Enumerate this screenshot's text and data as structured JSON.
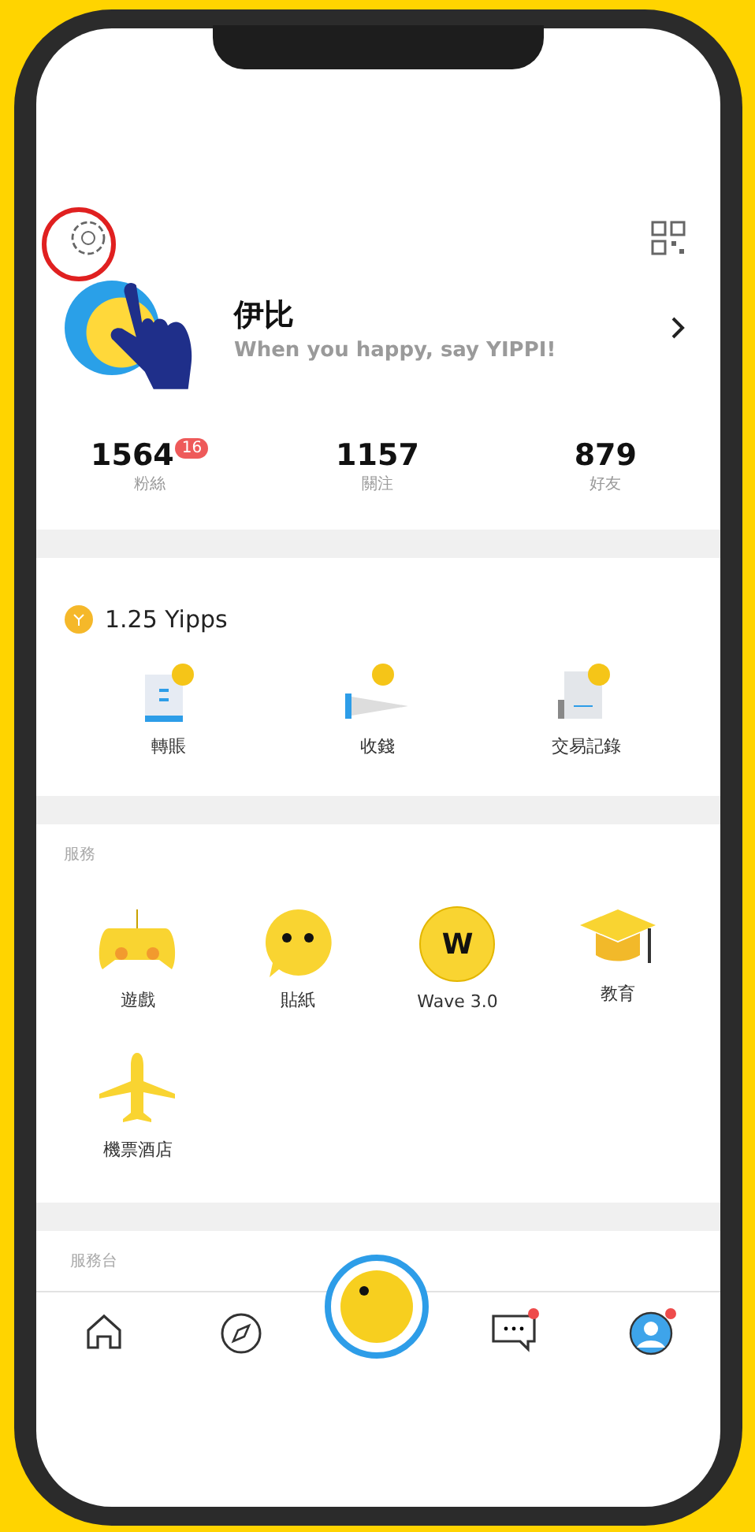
{
  "profile": {
    "name": "伊比",
    "motto": "When you happy, say YIPPI!"
  },
  "stats": [
    {
      "value": "1564",
      "label": "粉絲",
      "badge": "16"
    },
    {
      "value": "1157",
      "label": "關注"
    },
    {
      "value": "879",
      "label": "好友"
    }
  ],
  "wallet": {
    "balance": "1.25 Yipps",
    "actions": [
      {
        "kind": "transfer",
        "label": "轉賬"
      },
      {
        "kind": "receive",
        "label": "收錢"
      },
      {
        "kind": "history",
        "label": "交易記錄"
      }
    ]
  },
  "services": {
    "title": "服務",
    "items": [
      {
        "kind": "game",
        "label": "遊戲"
      },
      {
        "kind": "sticker",
        "label": "貼紙"
      },
      {
        "kind": "wave",
        "label": "Wave 3.0",
        "icon_text": "W"
      },
      {
        "kind": "education",
        "label": "教育"
      },
      {
        "kind": "travel",
        "label": "機票酒店"
      }
    ]
  },
  "service_desk": {
    "title": "服務台"
  },
  "tab_bar": [
    {
      "kind": "home",
      "notification": false
    },
    {
      "kind": "discover",
      "notification": false
    },
    {
      "kind": "center",
      "notification": false
    },
    {
      "kind": "messages",
      "notification": true
    },
    {
      "kind": "profile",
      "notification": true
    }
  ]
}
